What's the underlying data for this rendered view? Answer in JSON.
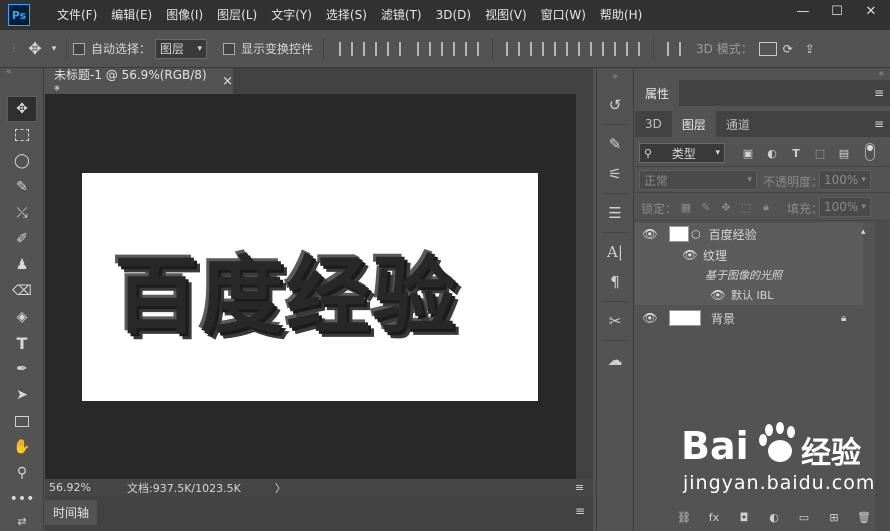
{
  "app": {
    "logo": "Ps",
    "menus": [
      "文件(F)",
      "编辑(E)",
      "图像(I)",
      "图层(L)",
      "文字(Y)",
      "选择(S)",
      "滤镜(T)",
      "3D(D)",
      "视图(V)",
      "窗口(W)",
      "帮助(H)"
    ],
    "window_controls": [
      "—",
      "☐",
      "✕"
    ]
  },
  "options": {
    "auto_select_label": "自动选择：",
    "auto_select_value": "图层",
    "show_transform_label": "显示变换控件",
    "mode_3d_label": "3D 模式："
  },
  "document": {
    "tab_title": "未标题-1 @ 56.9%(RGB/8) *",
    "tab_close": "×",
    "canvas_text": "百度经验",
    "zoom": "56.92%",
    "doc_info": "文档:937.5K/1023.5K",
    "doc_info_arrow": "〉"
  },
  "timeline": {
    "tab": "时间轴"
  },
  "panels": {
    "properties_tab": "属性",
    "tabs": [
      "3D",
      "图层",
      "通道"
    ],
    "active_tab": "图层",
    "filter_kind": "类型",
    "blend_mode": "正常",
    "opacity_label": "不透明度：",
    "opacity_value": "100%",
    "lock_label": "锁定：",
    "fill_label": "填充：",
    "fill_value": "100%",
    "layers": [
      {
        "name": "百度经验"
      },
      {
        "name": "纹理"
      },
      {
        "name": "基于图像的光照"
      },
      {
        "name": "默认 IBL"
      },
      {
        "name": "背景"
      }
    ]
  },
  "watermark": {
    "brand_left": "Bai",
    "brand_right": "经验",
    "url": "jingyan.baidu.com"
  }
}
